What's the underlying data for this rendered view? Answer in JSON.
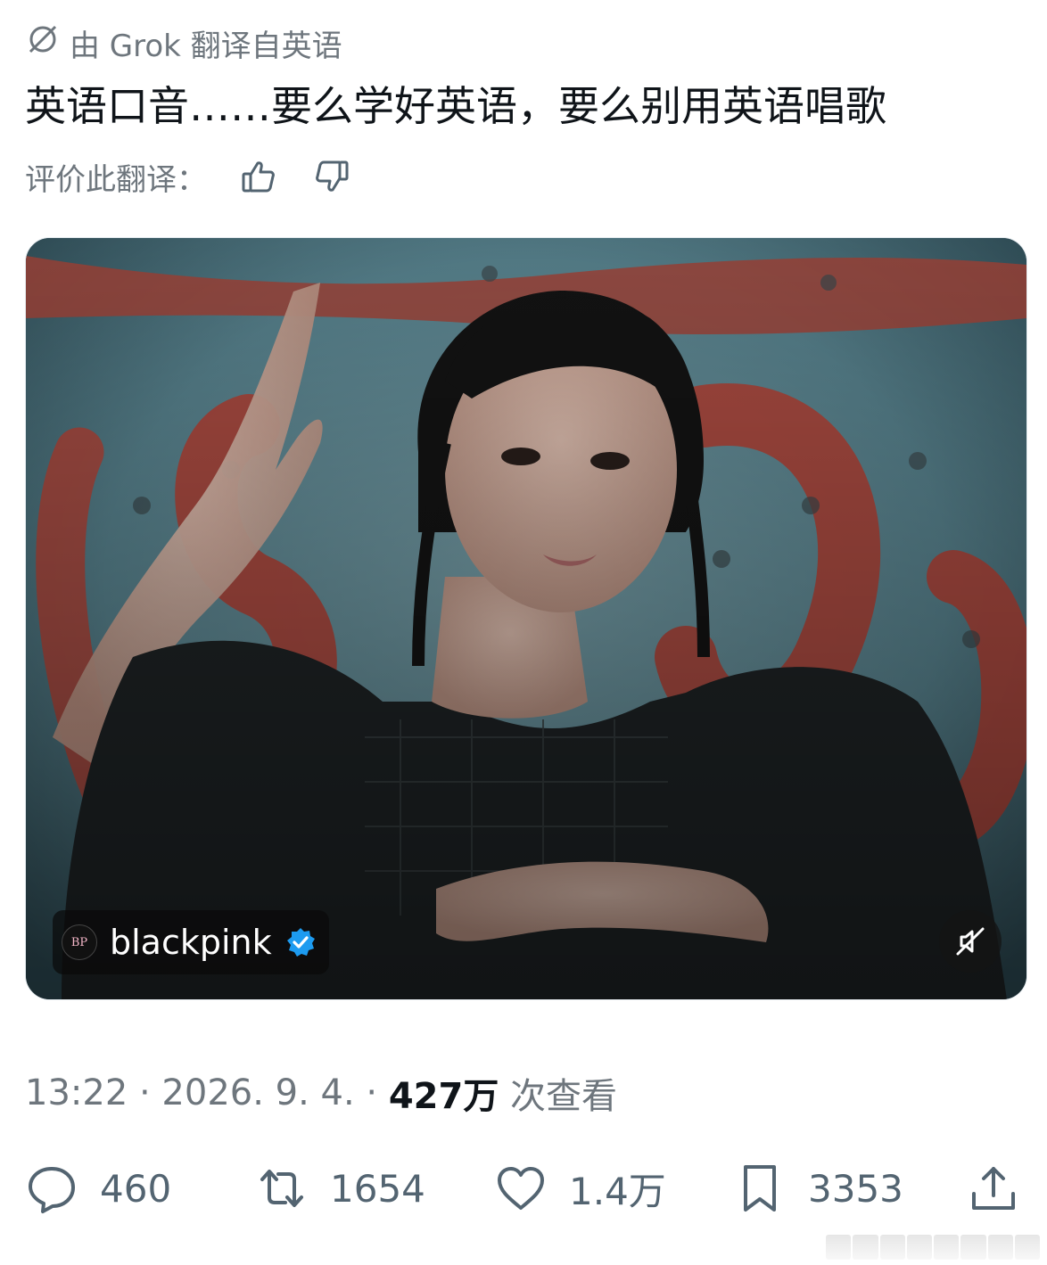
{
  "translation": {
    "label": "由 Grok 翻译自英语",
    "icon": "translate-icon"
  },
  "tweet": {
    "text": "英语口音……要么学好英语，要么别用英语唱歌"
  },
  "rate": {
    "label": "评价此翻译：",
    "up_icon": "thumbs-up-icon",
    "down_icon": "thumbs-down-icon"
  },
  "media": {
    "source_name": "blackpink",
    "avatar_text": "BP",
    "verified_icon": "verified-badge-icon",
    "mute_icon": "speaker-muted-icon"
  },
  "meta": {
    "time": "13:22 · 2026. 9. 4. · ",
    "views_count": "427万",
    "views_label": " 次查看"
  },
  "actions": {
    "reply_count": "460",
    "retweet_count": "1654",
    "like_count": "1.4万",
    "bookmark_count": "3353"
  },
  "colors": {
    "text": "#0f1419",
    "secondary": "#6e767d",
    "verified": "#1d9bf0",
    "action": "#536471"
  }
}
